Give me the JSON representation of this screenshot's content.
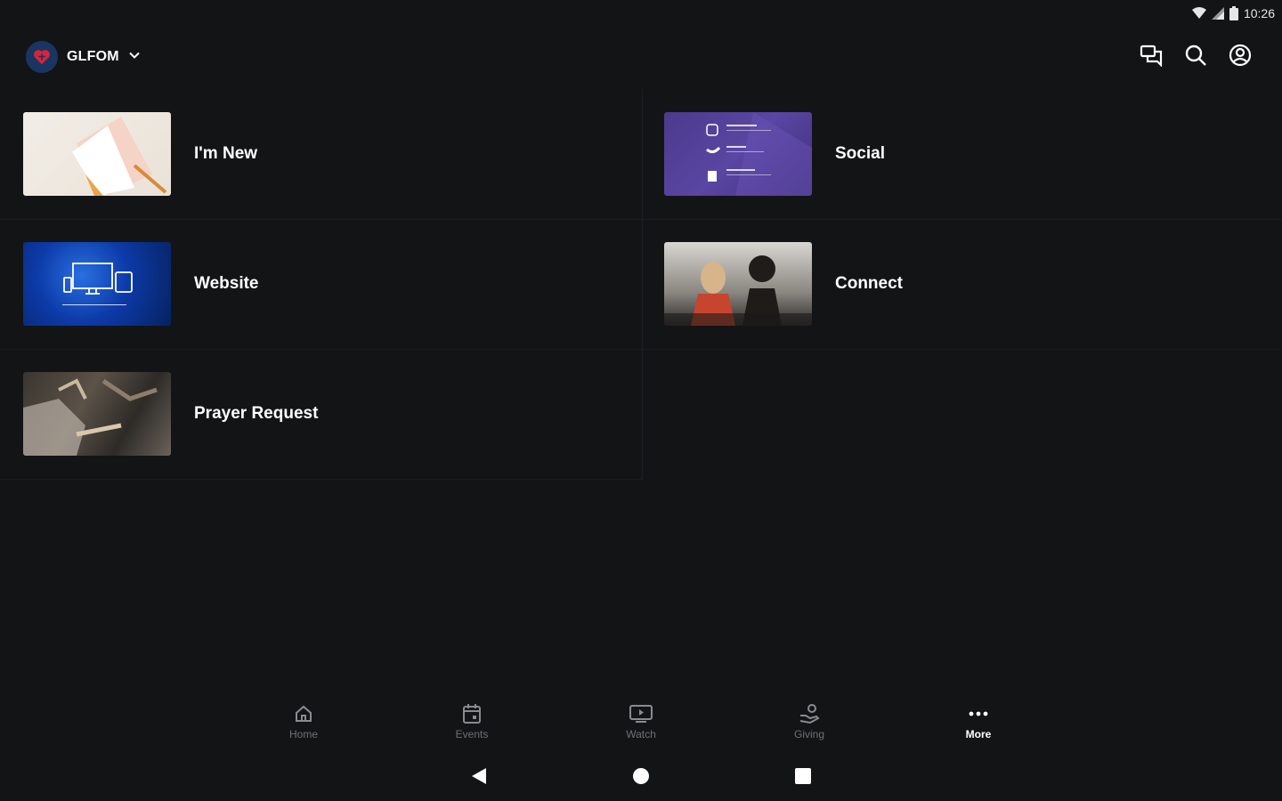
{
  "status_bar": {
    "time": "10:26",
    "wifi_icon": "wifi-icon",
    "signal_icon": "signal-icon",
    "battery_icon": "battery-icon"
  },
  "header": {
    "org_name": "GLFOM",
    "org_logo_icon": "heart-logo-icon",
    "actions": [
      {
        "name": "messages-button",
        "icon": "chat-icon"
      },
      {
        "name": "search-button",
        "icon": "search-icon"
      },
      {
        "name": "profile-button",
        "icon": "account-icon"
      }
    ]
  },
  "tiles": [
    {
      "label": "I'm New",
      "thumb": "notebook-image"
    },
    {
      "label": "Social",
      "thumb": "social-links-image"
    },
    {
      "label": "Website",
      "thumb": "devices-image"
    },
    {
      "label": "Connect",
      "thumb": "people-image"
    },
    {
      "label": "Prayer Request",
      "thumb": "worship-image"
    }
  ],
  "bottom_nav": [
    {
      "label": "Home",
      "icon": "home-icon",
      "active": false
    },
    {
      "label": "Events",
      "icon": "calendar-icon",
      "active": false
    },
    {
      "label": "Watch",
      "icon": "tv-icon",
      "active": false
    },
    {
      "label": "Giving",
      "icon": "giving-icon",
      "active": false
    },
    {
      "label": "More",
      "icon": "more-icon",
      "active": true
    }
  ],
  "colors": {
    "background": "#131416",
    "divider": "#1c1d20",
    "inactive_label": "#6f7074",
    "active_label": "#ffffff",
    "logo_red": "#d8243a"
  }
}
